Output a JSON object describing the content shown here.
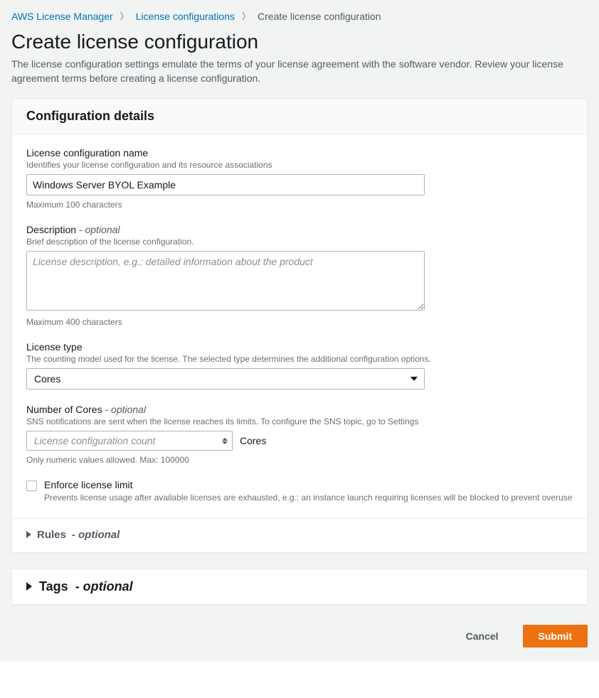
{
  "breadcrumb": {
    "root": "AWS License Manager",
    "parent": "License configurations",
    "current": "Create license configuration"
  },
  "page": {
    "title": "Create license configuration",
    "description": "The license configuration settings emulate the terms of your license agreement with the software vendor. Review your license agreement terms before creating a license configuration."
  },
  "panel": {
    "title": "Configuration details",
    "name": {
      "label": "License configuration name",
      "hint": "Identifies your license configuration and its resource associations",
      "value": "Windows Server BYOL Example",
      "constraint": "Maximum 100 characters"
    },
    "description": {
      "label": "Description",
      "optional": "- optional",
      "hint": "Brief description of the license configuration.",
      "placeholder": "License description, e.g.: detailed information about the product",
      "value": "",
      "constraint": "Maximum 400 characters"
    },
    "license_type": {
      "label": "License type",
      "hint": "The counting model used for the license. The selected type determines the additional configuration options.",
      "selected": "Cores"
    },
    "count": {
      "label": "Number of Cores",
      "optional": "- optional",
      "hint": "SNS notifications are sent when the license reaches its limits. To configure the SNS topic, go to Settings",
      "placeholder": "License configuration count",
      "unit": "Cores",
      "constraint": "Only numeric values allowed. Max: 100000"
    },
    "enforce": {
      "label": "Enforce license limit",
      "desc": "Prevents license usage after available licenses are exhausted, e.g.: an instance launch requiring licenses will be blocked to prevent overuse",
      "checked": false
    },
    "rules": {
      "label": "Rules",
      "optional": "- optional"
    }
  },
  "tags": {
    "label": "Tags",
    "optional": "- optional"
  },
  "actions": {
    "cancel": "Cancel",
    "submit": "Submit"
  }
}
